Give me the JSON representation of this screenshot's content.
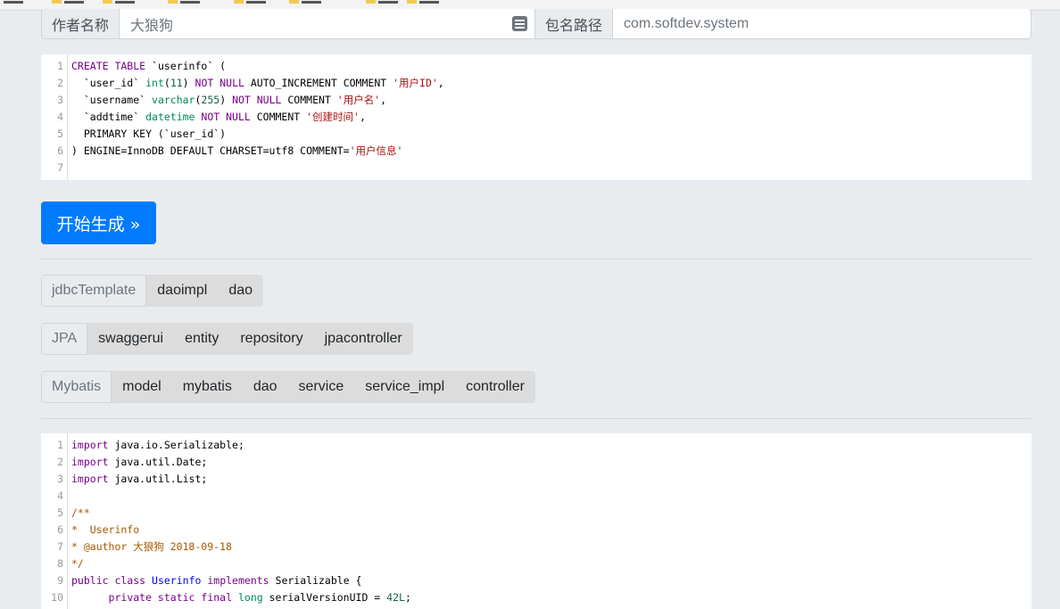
{
  "form": {
    "author_label": "作者名称",
    "author_value": "大狼狗",
    "package_label": "包名路径",
    "package_placeholder": "com.softdev.system"
  },
  "sql_editor": {
    "lines": [
      {
        "n": "1",
        "segs": [
          {
            "t": "CREATE TABLE",
            "c": "kw"
          },
          {
            "t": " `userinfo` (",
            "c": ""
          }
        ]
      },
      {
        "n": "2",
        "segs": [
          {
            "t": "  `user_id` ",
            "c": ""
          },
          {
            "t": "int",
            "c": "ty"
          },
          {
            "t": "(",
            "c": ""
          },
          {
            "t": "11",
            "c": "nm"
          },
          {
            "t": ") ",
            "c": ""
          },
          {
            "t": "NOT NULL",
            "c": "kw"
          },
          {
            "t": " AUTO_INCREMENT COMMENT ",
            "c": ""
          },
          {
            "t": "'用户ID'",
            "c": "st"
          },
          {
            "t": ",",
            "c": ""
          }
        ]
      },
      {
        "n": "3",
        "segs": [
          {
            "t": "  `username` ",
            "c": ""
          },
          {
            "t": "varchar",
            "c": "ty"
          },
          {
            "t": "(",
            "c": ""
          },
          {
            "t": "255",
            "c": "nm"
          },
          {
            "t": ") ",
            "c": ""
          },
          {
            "t": "NOT NULL",
            "c": "kw"
          },
          {
            "t": " COMMENT ",
            "c": ""
          },
          {
            "t": "'用户名'",
            "c": "st"
          },
          {
            "t": ",",
            "c": ""
          }
        ]
      },
      {
        "n": "4",
        "segs": [
          {
            "t": "  `addtime` ",
            "c": ""
          },
          {
            "t": "datetime",
            "c": "ty"
          },
          {
            "t": " ",
            "c": ""
          },
          {
            "t": "NOT NULL",
            "c": "kw"
          },
          {
            "t": " COMMENT ",
            "c": ""
          },
          {
            "t": "'创建时间'",
            "c": "st"
          },
          {
            "t": ",",
            "c": ""
          }
        ]
      },
      {
        "n": "5",
        "segs": [
          {
            "t": "  PRIMARY KEY (`user_id`)",
            "c": ""
          }
        ]
      },
      {
        "n": "6",
        "segs": [
          {
            "t": ") ENGINE=InnoDB DEFAULT CHARSET=utf8 COMMENT=",
            "c": ""
          },
          {
            "t": "'用户信息'",
            "c": "st"
          }
        ]
      },
      {
        "n": "7",
        "segs": []
      }
    ]
  },
  "generate_button": "开始生成 »",
  "template_groups": [
    {
      "label": "jdbcTemplate",
      "options": [
        "daoimpl",
        "dao"
      ]
    },
    {
      "label": "JPA",
      "options": [
        "swaggerui",
        "entity",
        "repository",
        "jpacontroller"
      ]
    },
    {
      "label": "Mybatis",
      "options": [
        "model",
        "mybatis",
        "dao",
        "service",
        "service_impl",
        "controller"
      ]
    }
  ],
  "output_editor": {
    "lines": [
      {
        "n": "1",
        "segs": [
          {
            "t": "import",
            "c": "kw"
          },
          {
            "t": " java.io.Serializable;",
            "c": ""
          }
        ]
      },
      {
        "n": "2",
        "segs": [
          {
            "t": "import",
            "c": "kw"
          },
          {
            "t": " java.util.Date;",
            "c": ""
          }
        ]
      },
      {
        "n": "3",
        "segs": [
          {
            "t": "import",
            "c": "kw"
          },
          {
            "t": " java.util.List;",
            "c": ""
          }
        ]
      },
      {
        "n": "4",
        "segs": []
      },
      {
        "n": "5",
        "segs": [
          {
            "t": "/**",
            "c": "cm"
          }
        ]
      },
      {
        "n": "6",
        "segs": [
          {
            "t": "*  Userinfo",
            "c": "cm"
          }
        ]
      },
      {
        "n": "7",
        "segs": [
          {
            "t": "* @author 大狼狗 2018-09-18",
            "c": "cm"
          }
        ]
      },
      {
        "n": "8",
        "segs": [
          {
            "t": "*/",
            "c": "cm"
          }
        ]
      },
      {
        "n": "9",
        "segs": [
          {
            "t": "public class",
            "c": "kw"
          },
          {
            "t": " ",
            "c": ""
          },
          {
            "t": "Userinfo",
            "c": "df"
          },
          {
            "t": " ",
            "c": ""
          },
          {
            "t": "implements",
            "c": "kw"
          },
          {
            "t": " Serializable {",
            "c": ""
          }
        ]
      },
      {
        "n": "10",
        "segs": [
          {
            "t": "      ",
            "c": ""
          },
          {
            "t": "private static final",
            "c": "kw"
          },
          {
            "t": " ",
            "c": ""
          },
          {
            "t": "long",
            "c": "ty"
          },
          {
            "t": " serialVersionUID = ",
            "c": ""
          },
          {
            "t": "42L",
            "c": "nm"
          },
          {
            "t": ";",
            "c": ""
          }
        ]
      }
    ]
  }
}
